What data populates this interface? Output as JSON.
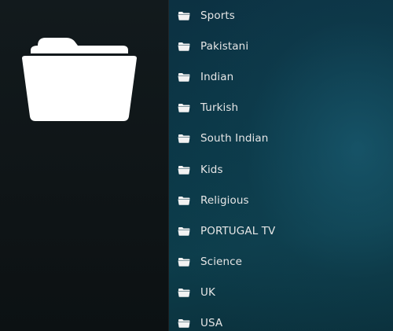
{
  "preview": {
    "icon": "folder-icon"
  },
  "list": {
    "item_icon": "folder-icon",
    "items": [
      {
        "label": "Sports"
      },
      {
        "label": "Pakistani"
      },
      {
        "label": "Indian"
      },
      {
        "label": "Turkish"
      },
      {
        "label": "South Indian"
      },
      {
        "label": "Kids"
      },
      {
        "label": "Religious"
      },
      {
        "label": "PORTUGAL TV"
      },
      {
        "label": "Science"
      },
      {
        "label": "UK"
      },
      {
        "label": "USA"
      }
    ]
  },
  "colors": {
    "left_pane_bg": "#111719",
    "right_pane_bg": "#0c3a48",
    "text": "#e6e6e6",
    "icon": "#ffffff"
  }
}
